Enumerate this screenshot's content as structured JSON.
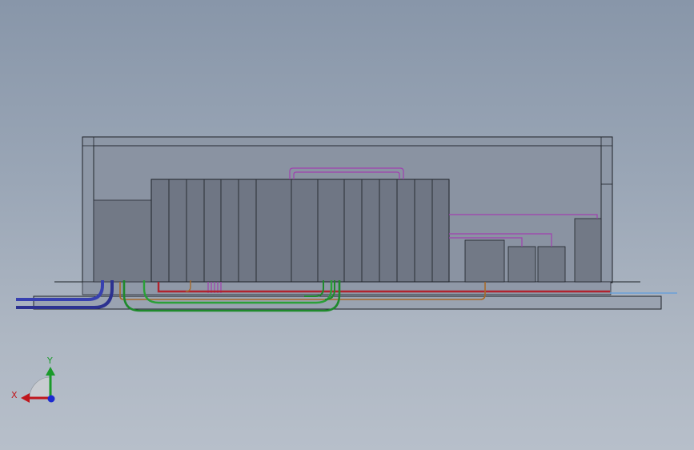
{
  "triad": {
    "x_label": "X",
    "y_label": "Y",
    "colors": {
      "x": "#c0161c",
      "y": "#1a9a2a",
      "z": "#1c2ad0"
    }
  },
  "pipe_colors": {
    "blue": "#3038a0",
    "green": "#1f8a2c",
    "red": "#b0232e",
    "brown": "#a86a2a",
    "magenta": "#a040b0",
    "cyan": "#6aa0d8"
  },
  "enclosure_colors": {
    "frame": "#1e2228",
    "interior": "#8a93a2",
    "cabinet": "#727986",
    "cabinet_dark": "#5f6673"
  }
}
